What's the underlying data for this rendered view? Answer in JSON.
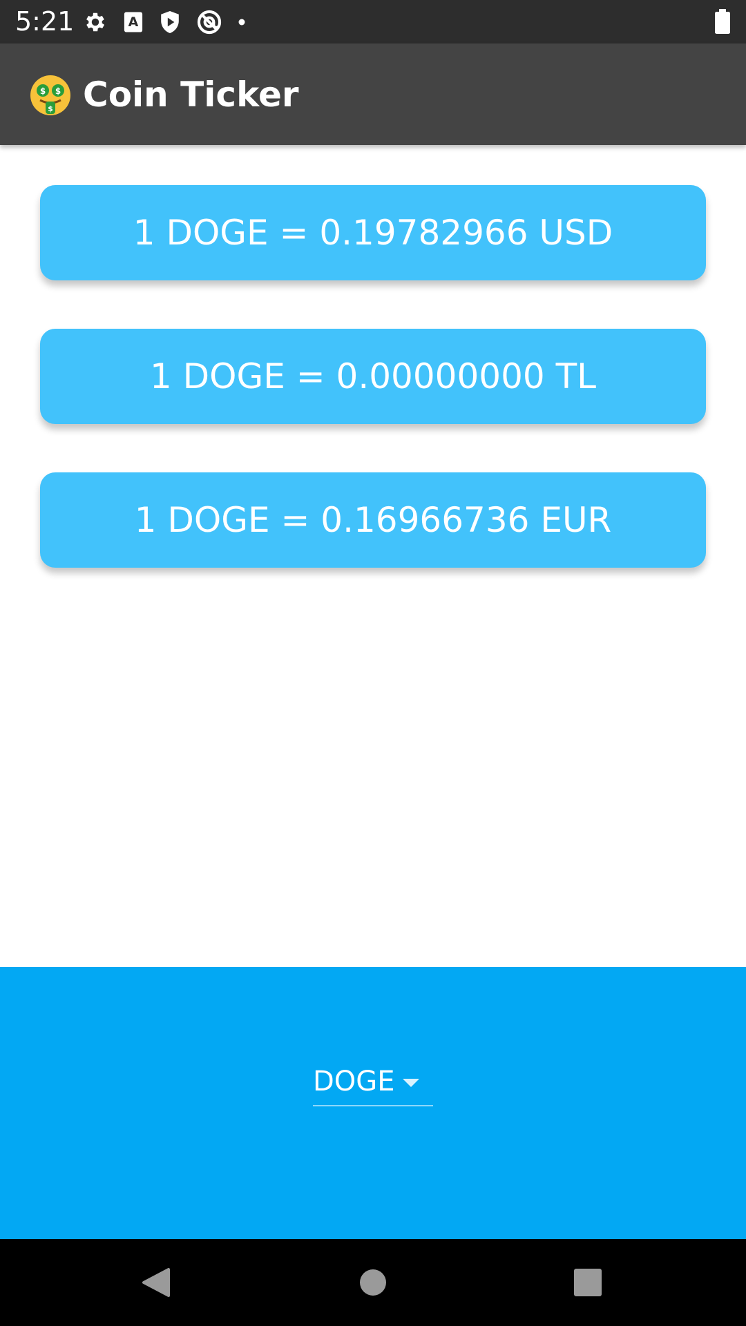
{
  "status_bar": {
    "time": "5:21",
    "icons": [
      "gear-icon",
      "text-a-icon",
      "shield-play-icon",
      "at-sign-icon",
      "dot-icon"
    ],
    "battery_icon": "battery-icon"
  },
  "app_bar": {
    "emoji_icon": "money-mouth-face-icon",
    "title": "Coin Ticker"
  },
  "rates": [
    {
      "label": "1 DOGE = 0.19782966 USD"
    },
    {
      "label": "1 DOGE = 0.00000000 TL"
    },
    {
      "label": "1 DOGE = 0.16966736 EUR"
    }
  ],
  "picker": {
    "selected": "DOGE",
    "arrow_icon": "caret-down-icon"
  },
  "nav_bar": {
    "buttons": [
      "back-icon",
      "home-icon",
      "recents-icon"
    ]
  },
  "colors": {
    "status_bar": "#2d2d2d",
    "app_bar": "#444444",
    "card": "#42c2fb",
    "picker_panel": "#03a8f3",
    "nav_bar": "#000000"
  }
}
